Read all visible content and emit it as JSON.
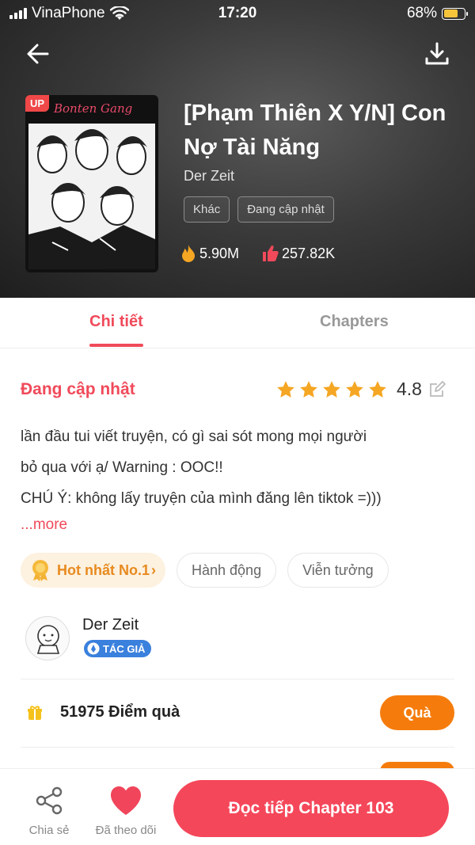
{
  "status_bar": {
    "carrier": "VinaPhone",
    "time": "17:20",
    "battery": "68%"
  },
  "book": {
    "title": "[Phạm Thiên X Y/N] Con Nợ Tài Năng",
    "author": "Der Zeit",
    "cover_badge": "UP",
    "cover_title": "Bonten Gang",
    "tags": [
      "Khác",
      "Đang cập nhật"
    ],
    "views": "5.90M",
    "likes": "257.82K"
  },
  "tabs": {
    "detail": "Chi tiết",
    "chapters": "Chapters"
  },
  "info": {
    "status": "Đang cập nhật",
    "rating": "4.8",
    "stars": 5,
    "description_lines": [
      "lần đầu tui viết truyện, có gì sai sót mong mọi người",
      "bỏ qua với ạ/ Warning : OOC!!",
      "CHÚ Ý: không lấy truyện của mình đăng lên tiktok =)))"
    ],
    "more": "...more"
  },
  "chips": {
    "hot": "Hot nhất No.1",
    "genre1": "Hành động",
    "genre2": "Viễn tưởng"
  },
  "author_card": {
    "name": "Der Zeit",
    "badge": "TÁC GIẢ"
  },
  "points": {
    "text": "51975 Điểm quà",
    "button": "Quà"
  },
  "bottom": {
    "share": "Chia sẻ",
    "follow": "Đã theo dõi",
    "read": "Đọc tiếp Chapter 103"
  },
  "colors": {
    "accent": "#f04a5a",
    "orange": "#f57c0c",
    "hot_bg": "#fdf1df",
    "star": "#f5a623"
  }
}
